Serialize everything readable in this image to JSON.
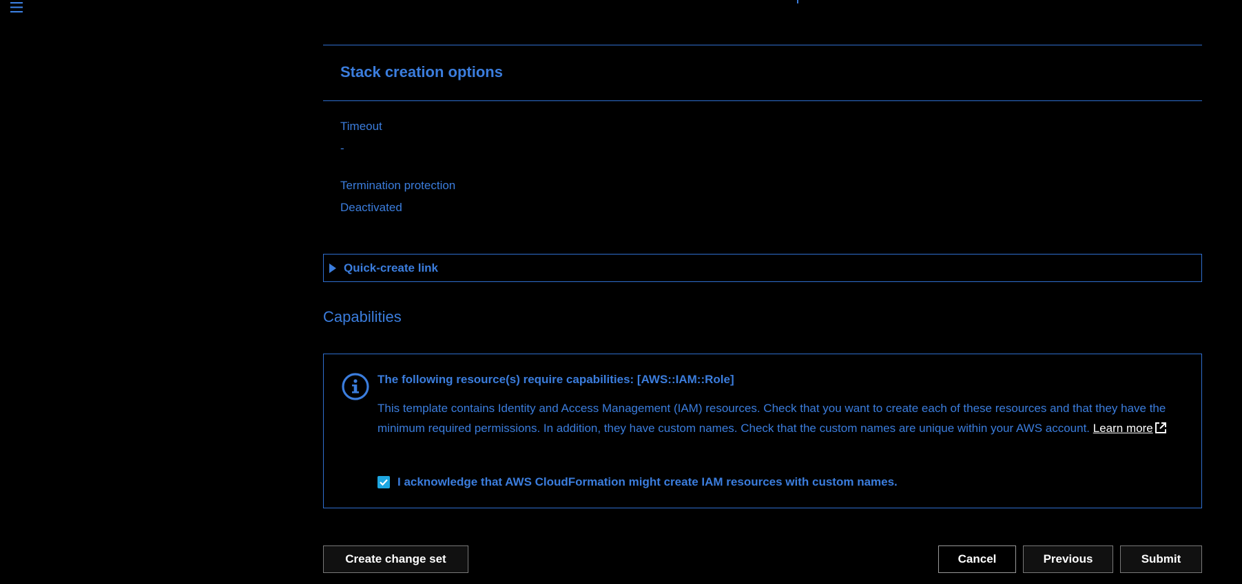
{
  "nav": {
    "menu_icon": "hamburger-menu-icon"
  },
  "stack_options": {
    "title": "Stack creation options",
    "timeout_label": "Timeout",
    "timeout_value": "-",
    "termination_label": "Termination protection",
    "termination_value": "Deactivated"
  },
  "quick_create": {
    "label": "Quick-create link",
    "icon": "caret-right-icon"
  },
  "capabilities": {
    "title": "Capabilities",
    "alert_icon": "info-icon",
    "alert_title": "The following resource(s) require capabilities: [AWS::IAM::Role]",
    "alert_body": "This template contains Identity and Access Management (IAM) resources. Check that you want to create each of these resources and that they have the minimum required permissions. In addition, they have custom names. Check that the custom names are unique within your AWS account.",
    "learn_more": "Learn more",
    "learn_more_icon": "external-link-icon",
    "ack_checked": true,
    "ack_label": "I acknowledge that AWS CloudFormation might create IAM resources with custom names."
  },
  "actions": {
    "create_change_set": "Create change set",
    "cancel": "Cancel",
    "previous": "Previous",
    "submit": "Submit"
  },
  "colors": {
    "accent": "#3b7ddd",
    "background": "#000000",
    "checkbox": "#1ea7e1"
  }
}
